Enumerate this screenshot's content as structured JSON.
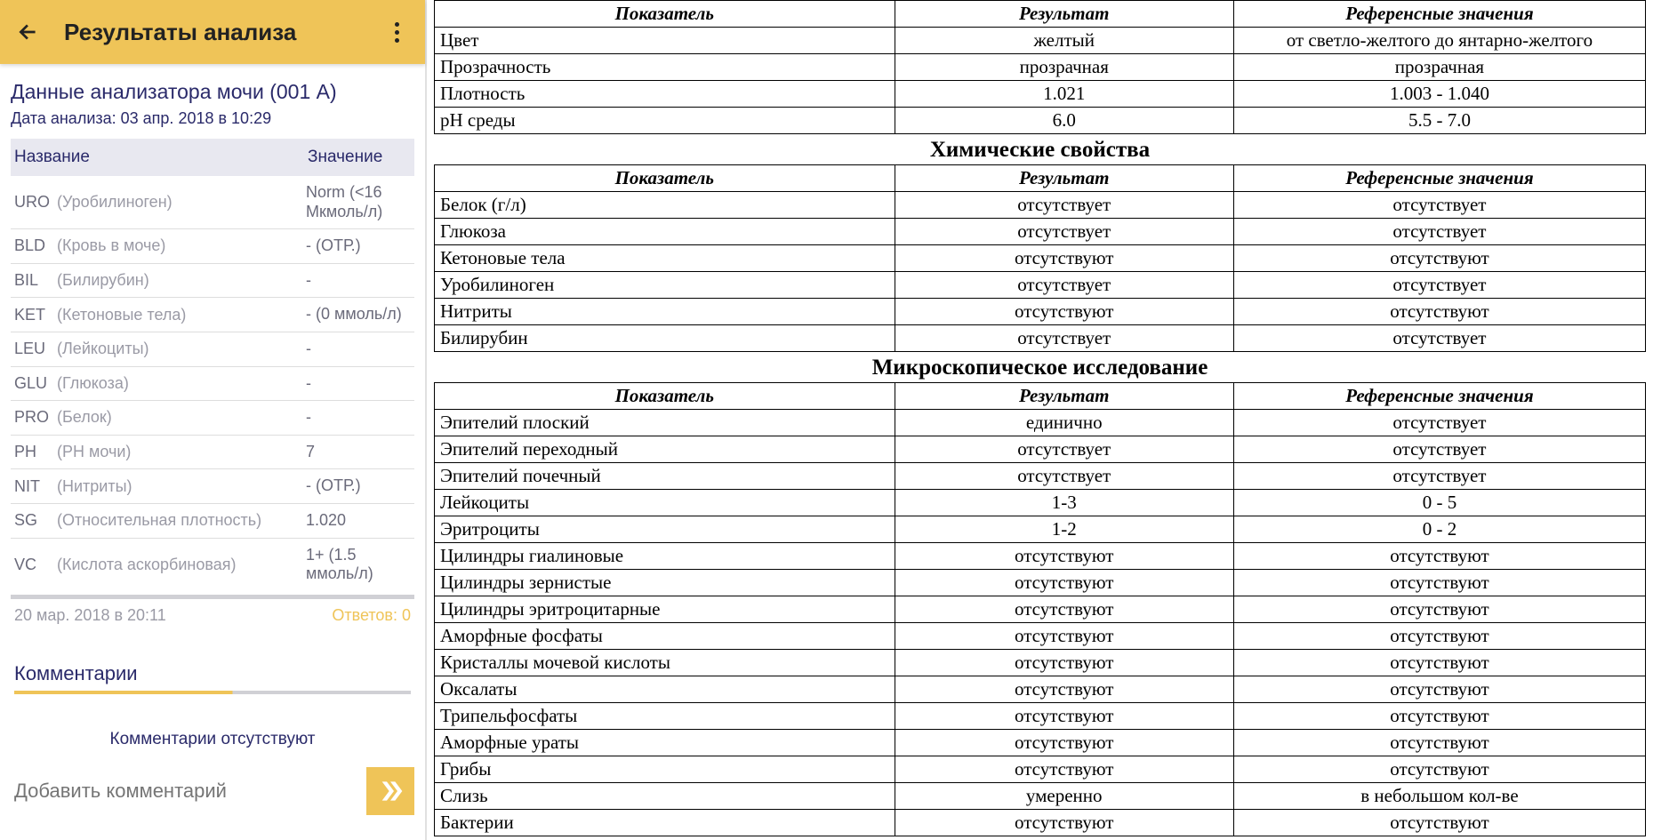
{
  "app": {
    "title": "Результаты анализа",
    "section_title": "Данные анализатора мочи (001 A)",
    "date_label": "Дата анализа: 03 апр. 2018 в 10:29",
    "table_headers": {
      "name": "Название",
      "value": "Значение"
    },
    "rows": [
      {
        "code": "URO",
        "desc": "(Уробилиноген)",
        "value": "Norm (<16 Мкмоль/л)"
      },
      {
        "code": "BLD",
        "desc": "(Кровь в моче)",
        "value": "- (ОТР.)"
      },
      {
        "code": "BIL",
        "desc": "(Билирубин)",
        "value": "-"
      },
      {
        "code": "KET",
        "desc": "(Кетоновые тела)",
        "value": "- (0 ммоль/л)"
      },
      {
        "code": "LEU",
        "desc": "(Лейкоциты)",
        "value": "-"
      },
      {
        "code": "GLU",
        "desc": "(Глюкоза)",
        "value": "-"
      },
      {
        "code": "PRO",
        "desc": "(Белок)",
        "value": "-"
      },
      {
        "code": "PH",
        "desc": "(РН мочи)",
        "value": "7"
      },
      {
        "code": "NIT",
        "desc": "(Нитриты)",
        "value": "- (ОТР.)"
      },
      {
        "code": "SG",
        "desc": "(Относительная плотность)",
        "value": "1.020"
      },
      {
        "code": "VC",
        "desc": "(Кислота аскорбиновая)",
        "value": "1+ (1.5 ммоль/л)"
      }
    ],
    "footer_date": "20 мар. 2018 в 20:11",
    "footer_answers": "Ответов: 0",
    "comments_title": "Комментарии",
    "no_comments": "Комментарии отсутствуют",
    "comment_placeholder": "Добавить комментарий"
  },
  "doc": {
    "headers": {
      "param": "Показатель",
      "result": "Результат",
      "ref": "Референсные значения"
    },
    "section1": [
      {
        "param": "Цвет",
        "result": "желтый",
        "ref": "от светло-желтого до янтарно-желтого"
      },
      {
        "param": "Прозрачность",
        "result": "прозрачная",
        "ref": "прозрачная"
      },
      {
        "param": "Плотность",
        "result": "1.021",
        "ref": "1.003 - 1.040"
      },
      {
        "param": "pH среды",
        "result": "6.0",
        "ref": "5.5 - 7.0"
      }
    ],
    "section2_title": "Химические свойства",
    "section2": [
      {
        "param": "Белок (г/л)",
        "result": "отсутствует",
        "ref": "отсутствует"
      },
      {
        "param": "Глюкоза",
        "result": "отсутствует",
        "ref": "отсутствует"
      },
      {
        "param": "Кетоновые тела",
        "result": "отсутствуют",
        "ref": "отсутствуют"
      },
      {
        "param": "Уробилиноген",
        "result": "отсутствует",
        "ref": "отсутствует"
      },
      {
        "param": "Нитриты",
        "result": "отсутствуют",
        "ref": "отсутствуют"
      },
      {
        "param": "Билирубин",
        "result": "отсутствует",
        "ref": "отсутствует"
      }
    ],
    "section3_title": "Микроскопическое исследование",
    "section3": [
      {
        "param": "Эпителий плоский",
        "result": "единично",
        "ref": "отсутствует"
      },
      {
        "param": "Эпителий переходный",
        "result": "отсутствует",
        "ref": "отсутствует"
      },
      {
        "param": "Эпителий почечный",
        "result": "отсутствует",
        "ref": "отсутствует"
      },
      {
        "param": "Лейкоциты",
        "result": "1-3",
        "ref": "0 - 5"
      },
      {
        "param": "Эритроциты",
        "result": "1-2",
        "ref": "0 - 2"
      },
      {
        "param": "Цилиндры гиалиновые",
        "result": "отсутствуют",
        "ref": "отсутствуют"
      },
      {
        "param": "Цилиндры зернистые",
        "result": "отсутствуют",
        "ref": "отсутствуют"
      },
      {
        "param": "Цилиндры эритроцитарные",
        "result": "отсутствуют",
        "ref": "отсутствуют"
      },
      {
        "param": "Аморфные фосфаты",
        "result": "отсутствуют",
        "ref": "отсутствуют"
      },
      {
        "param": "Кристаллы мочевой кислоты",
        "result": "отсутствуют",
        "ref": "отсутствуют"
      },
      {
        "param": "Оксалаты",
        "result": "отсутствуют",
        "ref": "отсутствуют"
      },
      {
        "param": "Трипельфосфаты",
        "result": "отсутствуют",
        "ref": "отсутствуют"
      },
      {
        "param": "Аморфные ураты",
        "result": "отсутствуют",
        "ref": "отсутствуют"
      },
      {
        "param": "Грибы",
        "result": "отсутствуют",
        "ref": "отсутствуют"
      },
      {
        "param": "Слизь",
        "result": "умеренно",
        "ref": "в небольшом кол-ве"
      },
      {
        "param": "Бактерии",
        "result": "отсутствуют",
        "ref": "отсутствуют"
      }
    ]
  }
}
